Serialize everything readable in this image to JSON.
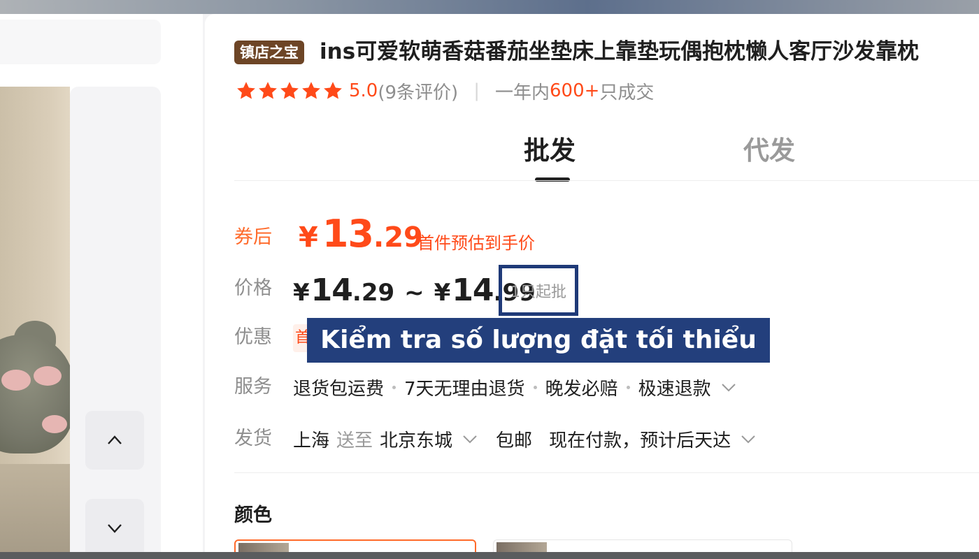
{
  "product": {
    "badge": "镇店之宝",
    "title": "ins可爱软萌香菇番茄坐垫床上靠垫玩偶抱枕懒人客厅沙发靠枕"
  },
  "rating": {
    "stars": 5,
    "score": "5.0",
    "reviews": "(9条评价)",
    "sales_prefix": "一年内",
    "sales_count": "600+",
    "sales_suffix": " 只成交"
  },
  "tabs": {
    "wholesale": "批发",
    "dropship": "代发"
  },
  "coupon": {
    "label": "券后",
    "currency": "¥",
    "price_int": "13",
    "price_dec": ".29",
    "note": "首件预估到手价"
  },
  "price": {
    "label": "价格",
    "currency": "¥",
    "low_int": "14",
    "low_dec": ".29",
    "separator": "~",
    "high_int": "14",
    "high_dec": ".99",
    "min_order": "1只起批"
  },
  "promo": {
    "label": "优惠",
    "tag_partial": "首"
  },
  "caption": "Kiểm tra số lượng đặt tối thiểu",
  "services": {
    "label": "服务",
    "items": [
      "退货包运费",
      "7天无理由退货",
      "晚发必赔",
      "极速退款"
    ]
  },
  "shipping": {
    "label": "发货",
    "from": "上海",
    "to_label": "送至",
    "destination": "北京东城",
    "free_shipping": "包邮",
    "eta": "现在付款，预计后天达"
  },
  "color": {
    "label": "颜色"
  },
  "colors": {
    "accent": "#ff4a19",
    "badge_bg": "#6d4526",
    "caption_bg": "#233f7c"
  }
}
